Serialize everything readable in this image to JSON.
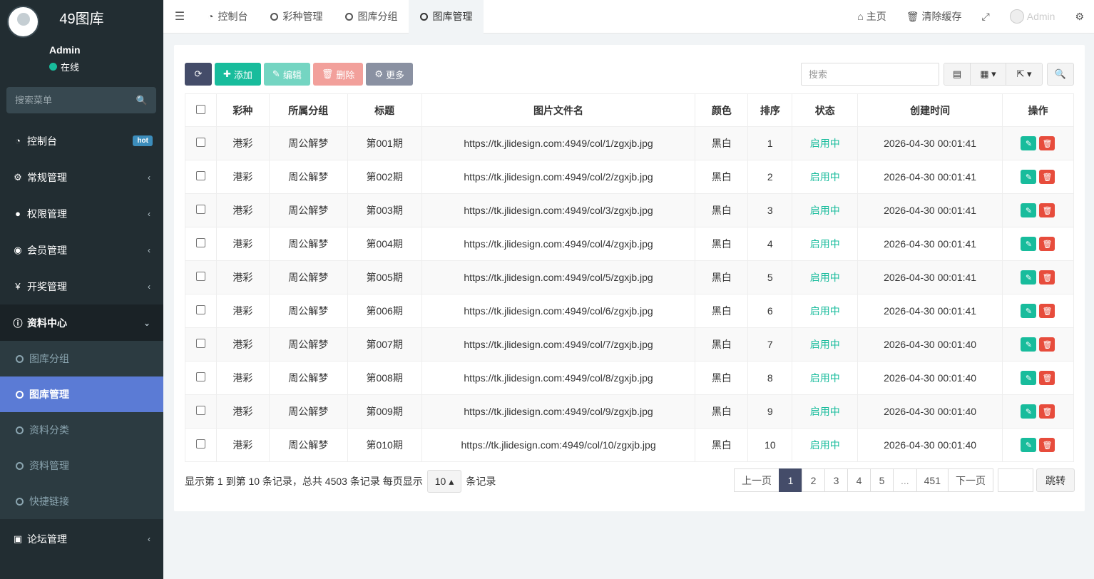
{
  "sidebar": {
    "logo": "49图库",
    "user_name": "Admin",
    "user_status": "在线",
    "search_placeholder": "搜索菜单",
    "menu": [
      {
        "label": "控制台",
        "icon": "dashboard-icon",
        "badge": "hot"
      },
      {
        "label": "常规管理",
        "icon": "cogs-icon"
      },
      {
        "label": "权限管理",
        "icon": "group-icon"
      },
      {
        "label": "会员管理",
        "icon": "user-circle-icon"
      },
      {
        "label": "开奖管理",
        "icon": "yen-icon"
      },
      {
        "label": "资料中心",
        "icon": "info-icon",
        "open": true
      }
    ],
    "submenu": [
      {
        "label": "图库分组"
      },
      {
        "label": "图库管理",
        "active": true
      },
      {
        "label": "资料分类"
      },
      {
        "label": "资料管理"
      },
      {
        "label": "快捷链接"
      }
    ],
    "last_menu": {
      "label": "论坛管理",
      "icon": "laptop-icon"
    }
  },
  "topnav": {
    "tabs": [
      {
        "label": "控制台",
        "icon": "dashboard-icon"
      },
      {
        "label": "彩种管理",
        "icon": "circle-icon"
      },
      {
        "label": "图库分组",
        "icon": "circle-icon"
      },
      {
        "label": "图库管理",
        "icon": "circle-icon",
        "active": true
      }
    ],
    "home": "主页",
    "clear_cache": "清除缓存",
    "admin": "Admin"
  },
  "toolbar": {
    "add": "添加",
    "edit": "编辑",
    "delete": "删除",
    "more": "更多",
    "search_placeholder": "搜索"
  },
  "table": {
    "columns": [
      "彩种",
      "所属分组",
      "标题",
      "图片文件名",
      "颜色",
      "排序",
      "状态",
      "创建时间",
      "操作"
    ],
    "rows": [
      [
        "港彩",
        "周公解梦",
        "第001期",
        "https://tk.jlidesign.com:4949/col/1/zgxjb.jpg",
        "黑白",
        "1",
        "启用中",
        "2026-04-30 00:01:41"
      ],
      [
        "港彩",
        "周公解梦",
        "第002期",
        "https://tk.jlidesign.com:4949/col/2/zgxjb.jpg",
        "黑白",
        "2",
        "启用中",
        "2026-04-30 00:01:41"
      ],
      [
        "港彩",
        "周公解梦",
        "第003期",
        "https://tk.jlidesign.com:4949/col/3/zgxjb.jpg",
        "黑白",
        "3",
        "启用中",
        "2026-04-30 00:01:41"
      ],
      [
        "港彩",
        "周公解梦",
        "第004期",
        "https://tk.jlidesign.com:4949/col/4/zgxjb.jpg",
        "黑白",
        "4",
        "启用中",
        "2026-04-30 00:01:41"
      ],
      [
        "港彩",
        "周公解梦",
        "第005期",
        "https://tk.jlidesign.com:4949/col/5/zgxjb.jpg",
        "黑白",
        "5",
        "启用中",
        "2026-04-30 00:01:41"
      ],
      [
        "港彩",
        "周公解梦",
        "第006期",
        "https://tk.jlidesign.com:4949/col/6/zgxjb.jpg",
        "黑白",
        "6",
        "启用中",
        "2026-04-30 00:01:41"
      ],
      [
        "港彩",
        "周公解梦",
        "第007期",
        "https://tk.jlidesign.com:4949/col/7/zgxjb.jpg",
        "黑白",
        "7",
        "启用中",
        "2026-04-30 00:01:40"
      ],
      [
        "港彩",
        "周公解梦",
        "第008期",
        "https://tk.jlidesign.com:4949/col/8/zgxjb.jpg",
        "黑白",
        "8",
        "启用中",
        "2026-04-30 00:01:40"
      ],
      [
        "港彩",
        "周公解梦",
        "第009期",
        "https://tk.jlidesign.com:4949/col/9/zgxjb.jpg",
        "黑白",
        "9",
        "启用中",
        "2026-04-30 00:01:40"
      ],
      [
        "港彩",
        "周公解梦",
        "第010期",
        "https://tk.jlidesign.com:4949/col/10/zgxjb.jpg",
        "黑白",
        "10",
        "启用中",
        "2026-04-30 00:01:40"
      ]
    ]
  },
  "pagination": {
    "info": "显示第 1 到第 10 条记录，总共 4503 条记录 每页显示",
    "page_size": "10",
    "suffix": "条记录",
    "prev": "上一页",
    "pages": [
      "1",
      "2",
      "3",
      "4",
      "5",
      "...",
      "451"
    ],
    "next": "下一页",
    "jump": "跳转"
  }
}
